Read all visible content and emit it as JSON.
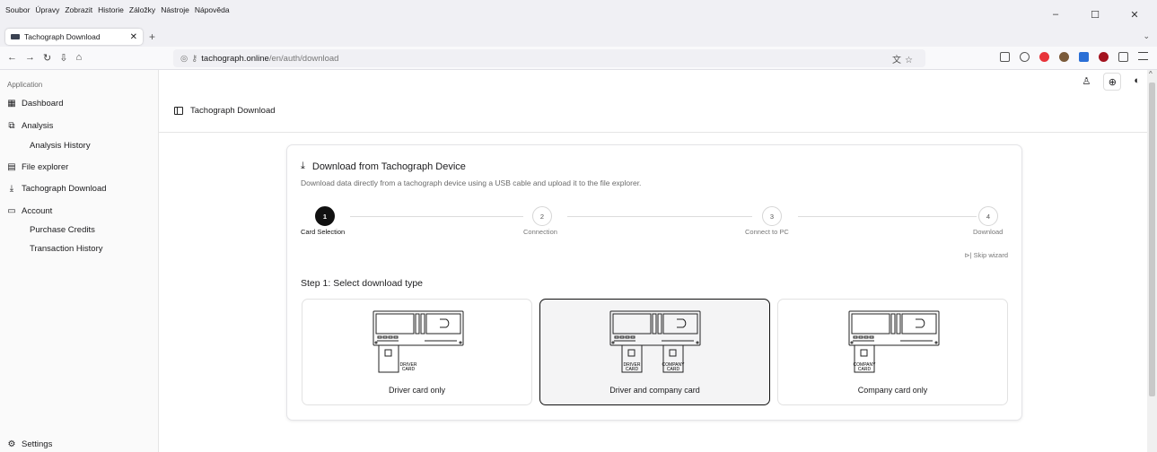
{
  "browser": {
    "menu": [
      "Soubor",
      "Úpravy",
      "Zobrazit",
      "Historie",
      "Záložky",
      "Nástroje",
      "Nápověda"
    ],
    "tab_title": "Tachograph Download",
    "url_domain": "tachograph.online",
    "url_path": "/en/auth/download"
  },
  "sidebar": {
    "section": "Application",
    "items": [
      {
        "label": "Dashboard",
        "icon": "dashboard-icon"
      },
      {
        "label": "Analysis",
        "icon": "analysis-icon"
      },
      {
        "label": "Analysis History",
        "sub": true
      },
      {
        "label": "File explorer",
        "icon": "file-icon"
      },
      {
        "label": "Tachograph Download",
        "icon": "download-icon"
      },
      {
        "label": "Account",
        "icon": "card-icon"
      },
      {
        "label": "Purchase Credits",
        "sub": true
      },
      {
        "label": "Transaction History",
        "sub": true
      }
    ],
    "settings": "Settings"
  },
  "header": {
    "title": "Tachograph Download"
  },
  "card": {
    "title": "Download from Tachograph Device",
    "description": "Download data directly from a tachograph device using a USB cable and upload it to the file explorer.",
    "steps": [
      {
        "num": "1",
        "label": "Card Selection",
        "active": true
      },
      {
        "num": "2",
        "label": "Connection"
      },
      {
        "num": "3",
        "label": "Connect to PC"
      },
      {
        "num": "4",
        "label": "Download"
      }
    ],
    "skip": "Skip wizard",
    "step_heading": "Step 1: Select download type",
    "options": [
      {
        "label": "Driver card only",
        "cards": [
          "DRIVER CARD"
        ]
      },
      {
        "label": "Driver and company card",
        "cards": [
          "DRIVER CARD",
          "COMPANY CARD"
        ],
        "selected": true
      },
      {
        "label": "Company card only",
        "cards": [
          "COMPANY CARD"
        ]
      }
    ]
  }
}
